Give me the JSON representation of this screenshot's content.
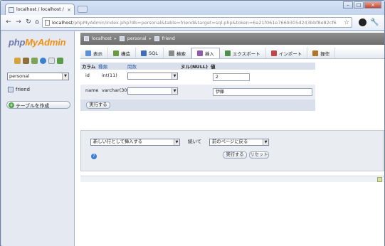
{
  "browser": {
    "tab_title": "localhost / localhost / perso",
    "tab_close": "×",
    "url_host": "localhost",
    "url_rest": "/phpMyAdmin/index.php?db=personal&table=friend&target=sql.php&token=6a21f061e7669305d243bbf8e82cf6"
  },
  "left": {
    "logo_php": "php",
    "logo_my": "My",
    "logo_admin": "Admin",
    "db_select": "personal",
    "table_link": "friend",
    "create_table": "テーブルを作成"
  },
  "breadcrumb": {
    "server": "localhost",
    "database": "personal",
    "table": "friend"
  },
  "tabs": [
    {
      "label": "表示",
      "color": "#5b8fd8"
    },
    {
      "label": "構造",
      "color": "#6a9b3e"
    },
    {
      "label": "SQL",
      "color": "#3f6fb8"
    },
    {
      "label": "検索",
      "color": "#8a8a8a"
    },
    {
      "label": "挿入",
      "color": "#8f5aa6"
    },
    {
      "label": "エクスポート",
      "color": "#4f8f4a"
    },
    {
      "label": "インポート",
      "color": "#c04848"
    },
    {
      "label": "操作",
      "color": "#b0772a"
    }
  ],
  "insert_table": {
    "headers": {
      "column": "カラム",
      "type": "種類",
      "function": "関数",
      "null": "ヌル(NULL)",
      "value": "値"
    },
    "rows": [
      {
        "name": "id",
        "type": "int(11)",
        "value": "2"
      },
      {
        "name": "name",
        "type": "varchar(30)",
        "value": "伊藤"
      }
    ],
    "submit": "実行する"
  },
  "options": {
    "insert_mode": "新しい行として挿入する",
    "then_label": "続いて",
    "after_action": "前のページに戻る",
    "submit": "実行する",
    "reset": "リセット"
  }
}
